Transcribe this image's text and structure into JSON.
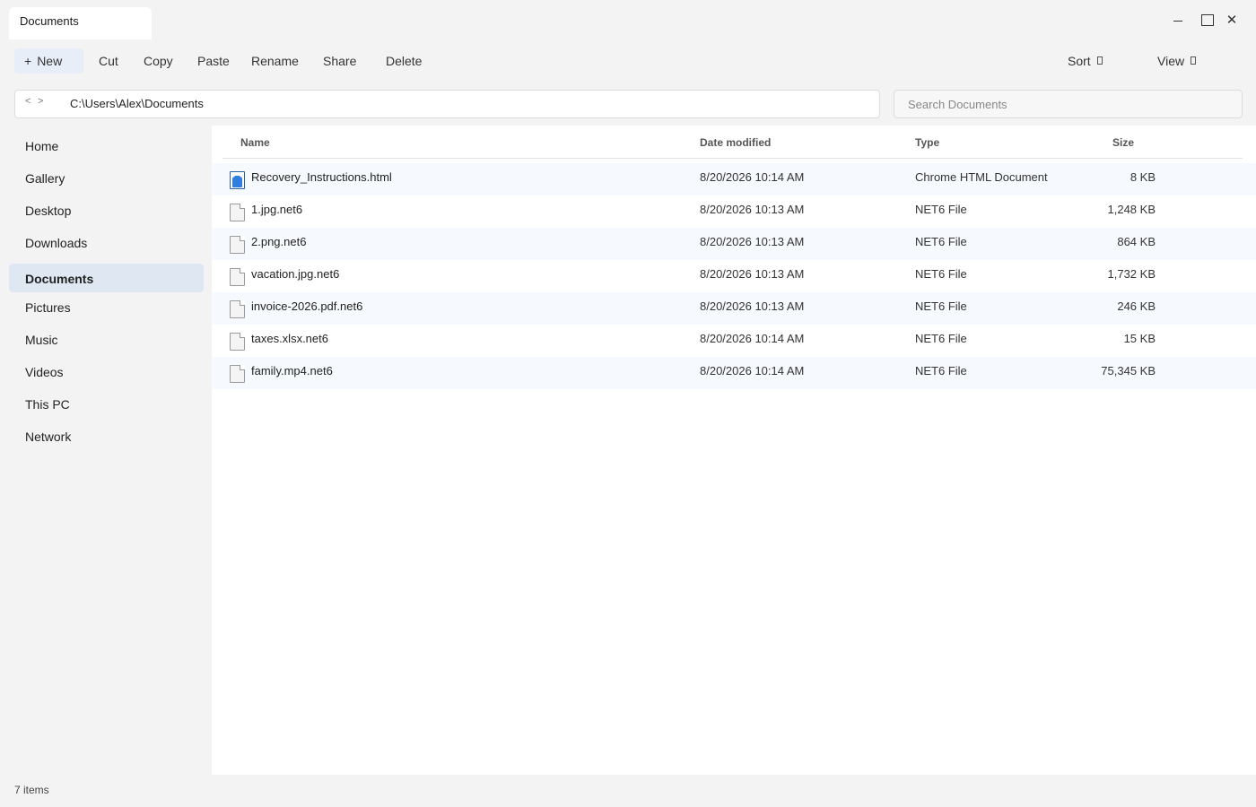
{
  "window": {
    "tab_title": "Documents",
    "minimize_label": "",
    "close_label": "✕"
  },
  "toolbar": {
    "new_icon": "+",
    "new_label": "New",
    "cut_label": "Cut",
    "copy_label": "Copy",
    "paste_label": "Paste",
    "rename_label": "Rename",
    "share_label": "Share",
    "delete_label": "Delete",
    "sort_label": "Sort",
    "view_label": "View"
  },
  "address": {
    "back": "<",
    "forward": ">",
    "path": "C:\\Users\\Alex\\Documents"
  },
  "search": {
    "placeholder": "Search Documents",
    "value": ""
  },
  "sidebar": {
    "items": [
      {
        "label": "Home"
      },
      {
        "label": "Gallery"
      },
      {
        "label": "Desktop"
      },
      {
        "label": "Downloads"
      },
      {
        "label": "Documents",
        "active": true
      },
      {
        "label": "Pictures"
      },
      {
        "label": "Music"
      },
      {
        "label": "Videos"
      },
      {
        "label": "This PC"
      },
      {
        "label": "Network"
      }
    ]
  },
  "table": {
    "columns": {
      "name": "Name",
      "date": "Date modified",
      "type": "Type",
      "size": "Size"
    },
    "rows": [
      {
        "name": "Recovery_Instructions.html",
        "date": "8/20/2026 10:14 AM",
        "type": "Chrome HTML Document",
        "size": "8 KB",
        "icon": "html-document-icon"
      },
      {
        "name": "1.jpg.net6",
        "date": "8/20/2026 10:13 AM",
        "type": "NET6 File",
        "size": "1,248 KB",
        "icon": "file-icon"
      },
      {
        "name": "2.png.net6",
        "date": "8/20/2026 10:13 AM",
        "type": "NET6 File",
        "size": "864 KB",
        "icon": "file-icon"
      },
      {
        "name": "vacation.jpg.net6",
        "date": "8/20/2026 10:13 AM",
        "type": "NET6 File",
        "size": "1,732 KB",
        "icon": "file-icon"
      },
      {
        "name": "invoice-2026.pdf.net6",
        "date": "8/20/2026 10:13 AM",
        "type": "NET6 File",
        "size": "246 KB",
        "icon": "file-icon"
      },
      {
        "name": "taxes.xlsx.net6",
        "date": "8/20/2026 10:14 AM",
        "type": "NET6 File",
        "size": "15 KB",
        "icon": "file-icon"
      },
      {
        "name": "family.mp4.net6",
        "date": "8/20/2026 10:14 AM",
        "type": "NET6 File",
        "size": "75,345 KB",
        "icon": "file-icon"
      }
    ]
  },
  "status": {
    "item_count": "7 items"
  },
  "colors": {
    "selected_nav": "#dfe7f3",
    "row_alt": "#f6f9fd",
    "html_icon": "#2f7fe0"
  }
}
